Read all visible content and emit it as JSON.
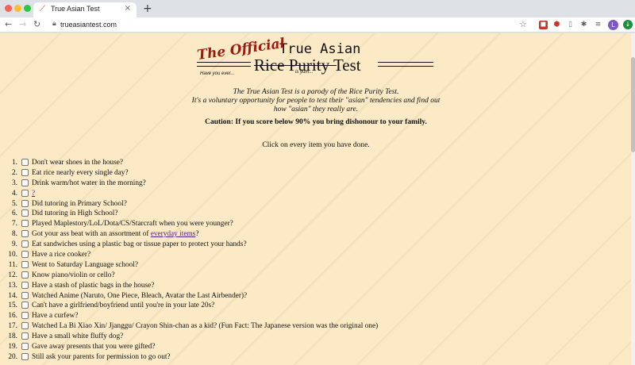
{
  "browser": {
    "tab_title": "True Asian Test",
    "url": "trueasiantest.com",
    "avatar_letter": "L"
  },
  "logo": {
    "top_text": "True Asian",
    "official_text": "The Official",
    "bottom_text": "Rice Purity Test",
    "have_you_ever": "Have you ever...",
    "is_yum": "is yum..."
  },
  "intro": {
    "line1": "The True Asian Test is a parody of the Rice Purity Test.",
    "line2": "It's a voluntary opportunity for people to test their \"asian\" tendencies and find out",
    "line3": "how \"asian\" they really are.",
    "caution": "Caution: If you score below 90% you bring dishonour to your family.",
    "instruction": "Click on every item you have done."
  },
  "items": [
    {
      "num": "1.",
      "text": "Don't wear shoes in the house?"
    },
    {
      "num": "2.",
      "text": "Eat rice nearly every single day?"
    },
    {
      "num": "3.",
      "text": "Drink warm/hot water in the morning?"
    },
    {
      "num": "4.",
      "text": "",
      "link": "?",
      "after": ""
    },
    {
      "num": "5.",
      "text": "Did tutoring in Primary School?"
    },
    {
      "num": "6.",
      "text": "Did tutoring in High School?"
    },
    {
      "num": "7.",
      "text": "Played Maplestory/LoL/Dota/CS/Starcraft when you were younger?"
    },
    {
      "num": "8.",
      "text": "Got your ass beat with an assortment of ",
      "link": "everyday items",
      "after": "?"
    },
    {
      "num": "9.",
      "text": "Eat sandwiches using a plastic bag or tissue paper to protect your hands?"
    },
    {
      "num": "10.",
      "text": "Have a rice cooker?"
    },
    {
      "num": "11.",
      "text": "Went to Saturday Language school?"
    },
    {
      "num": "12.",
      "text": "Know piano/violin or cello?"
    },
    {
      "num": "13.",
      "text": "Have a stash of plastic bags in the house?"
    },
    {
      "num": "14.",
      "text": "Watched Anime (Naruto, One Piece, Bleach, Avatar the Last Airbender)?"
    },
    {
      "num": "15.",
      "text": "Can't have a girlfriend/boyfriend until you're in your late 20s?"
    },
    {
      "num": "16.",
      "text": "Have a curfew?"
    },
    {
      "num": "17.",
      "text": "Watched La Bi Xiao Xin/ Jjanggu/ Crayon Shin-chan as a kid? (Fun Fact: The Japanese version was the original one)"
    },
    {
      "num": "18.",
      "text": "Have a small white fluffy dog?"
    },
    {
      "num": "19.",
      "text": "Gave away presents that you were gifted?"
    },
    {
      "num": "20.",
      "text": "Still ask your parents for permission to go out?"
    }
  ]
}
